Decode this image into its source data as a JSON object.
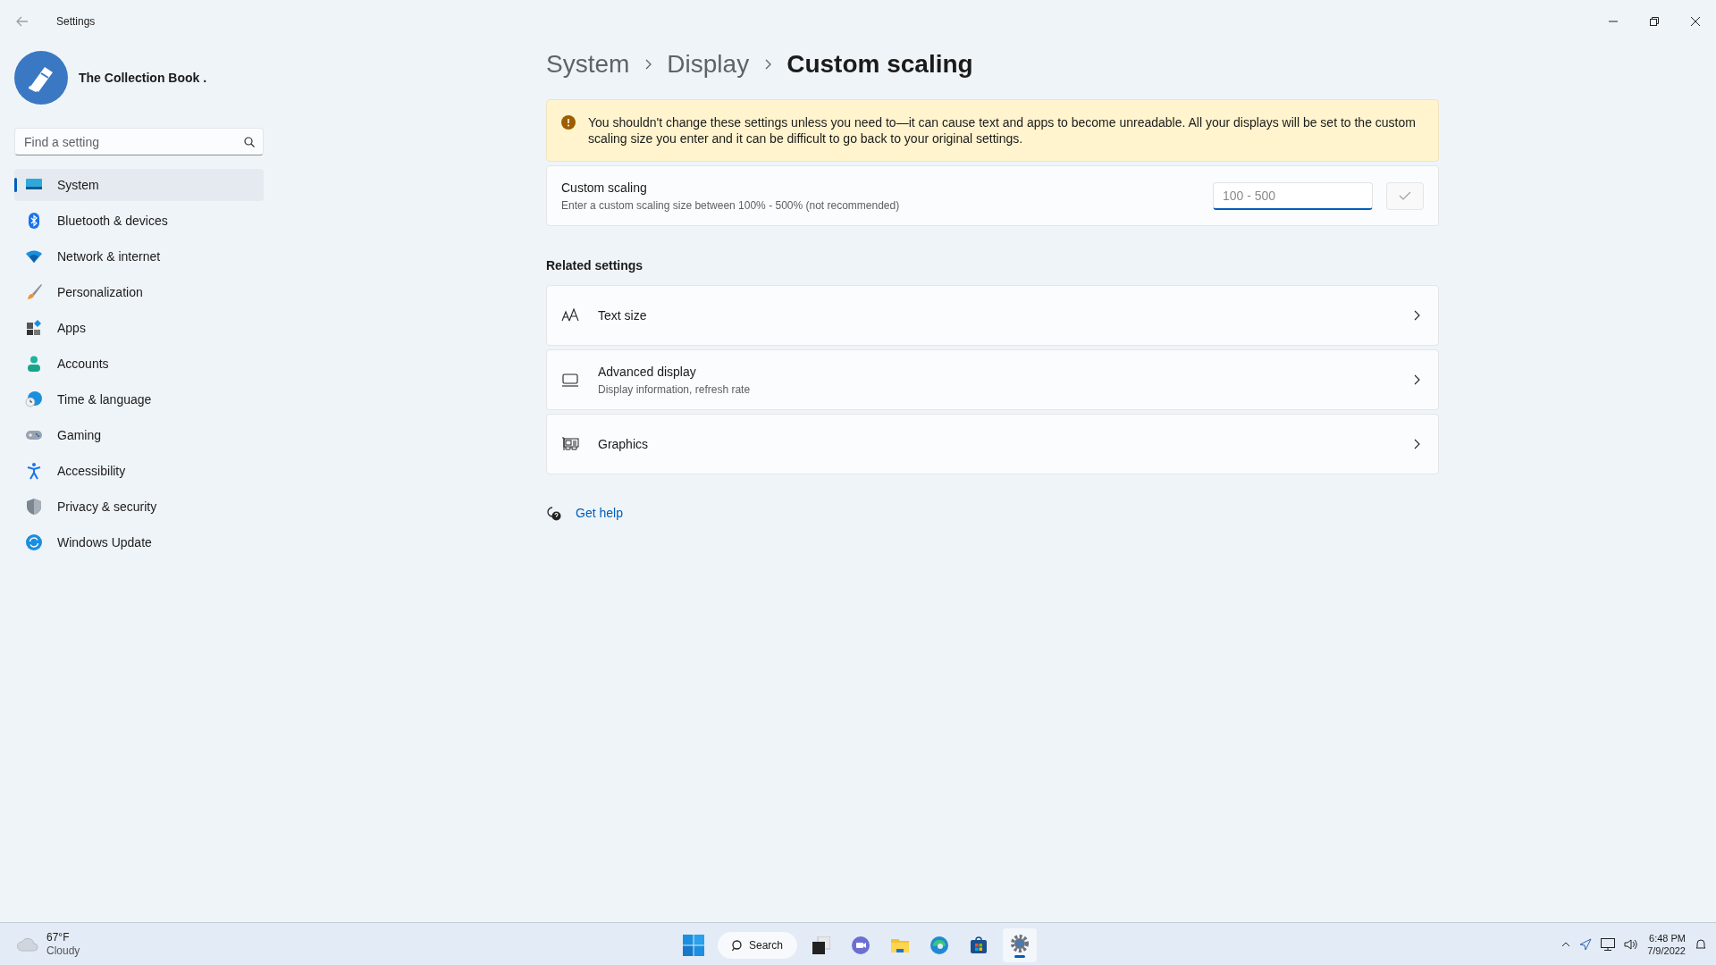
{
  "window": {
    "title": "Settings"
  },
  "account": {
    "name": "The Collection Book ."
  },
  "search": {
    "placeholder": "Find a setting"
  },
  "sidebar": {
    "items": [
      {
        "label": "System",
        "selected": true
      },
      {
        "label": "Bluetooth & devices",
        "selected": false
      },
      {
        "label": "Network & internet",
        "selected": false
      },
      {
        "label": "Personalization",
        "selected": false
      },
      {
        "label": "Apps",
        "selected": false
      },
      {
        "label": "Accounts",
        "selected": false
      },
      {
        "label": "Time & language",
        "selected": false
      },
      {
        "label": "Gaming",
        "selected": false
      },
      {
        "label": "Accessibility",
        "selected": false
      },
      {
        "label": "Privacy & security",
        "selected": false
      },
      {
        "label": "Windows Update",
        "selected": false
      }
    ]
  },
  "breadcrumb": [
    "System",
    "Display",
    "Custom scaling"
  ],
  "warning": "You shouldn't change these settings unless you need to—it can cause text and apps to become unreadable. All your displays will be set to the custom scaling size you enter and it can be difficult to go back to your original settings.",
  "custom_scaling": {
    "title": "Custom scaling",
    "description": "Enter a custom scaling size between 100% - 500% (not recommended)",
    "placeholder": "100 - 500"
  },
  "related_settings": {
    "heading": "Related settings",
    "items": [
      {
        "title": "Text size"
      },
      {
        "title": "Advanced display",
        "subtitle": "Display information, refresh rate"
      },
      {
        "title": "Graphics"
      }
    ]
  },
  "help_link": "Get help",
  "taskbar": {
    "weather": {
      "temperature": "67°F",
      "condition": "Cloudy"
    },
    "search_label": "Search",
    "clock": {
      "time": "6:48 PM",
      "date": "7/9/2022"
    }
  }
}
